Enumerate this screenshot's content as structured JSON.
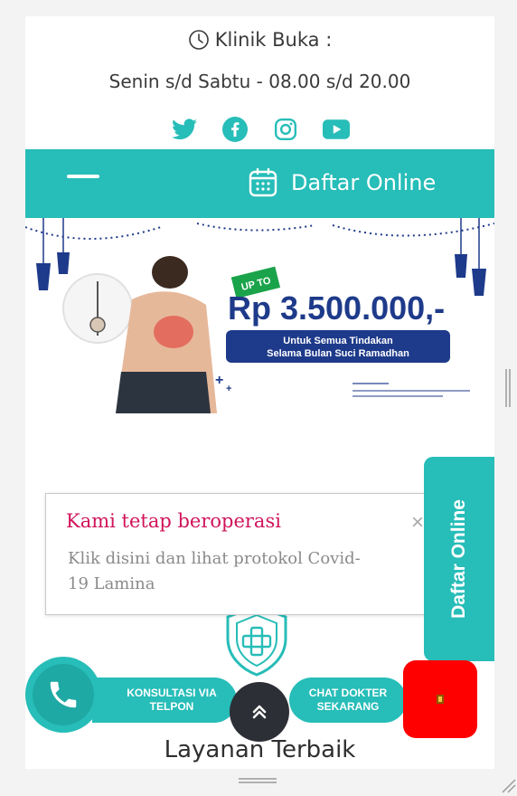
{
  "header": {
    "hours_title": "Klinik Buka :",
    "hours_text": "Senin s/d Sabtu - 08.00 s/d 20.00",
    "socials": [
      "twitter-icon",
      "facebook-icon",
      "instagram-icon",
      "youtube-icon"
    ]
  },
  "navbar": {
    "daftar_label": "Daftar Online"
  },
  "banner": {
    "badge": "UP TO",
    "amount": "Rp 3.500.000,-",
    "subtitle_line1": "Untuk Semua Tindakan",
    "subtitle_line2": "Selama Bulan Suci Ramadhan"
  },
  "popup": {
    "title": "Kami tetap beroperasi",
    "text": "Klik disini dan lihat protokol Covid-19 Lamina",
    "close": "×"
  },
  "side_tab": {
    "label": "Daftar Online"
  },
  "bottom": {
    "konsultasi": "KONSULTASI VIA TELPON",
    "chat": "CHAT DOKTER SEKARANG"
  },
  "section": {
    "title": "Layanan Terbaik"
  },
  "colors": {
    "teal": "#27bdb8",
    "pink": "#d0145a",
    "navy": "#1e3a8a",
    "red": "#ff0000"
  }
}
